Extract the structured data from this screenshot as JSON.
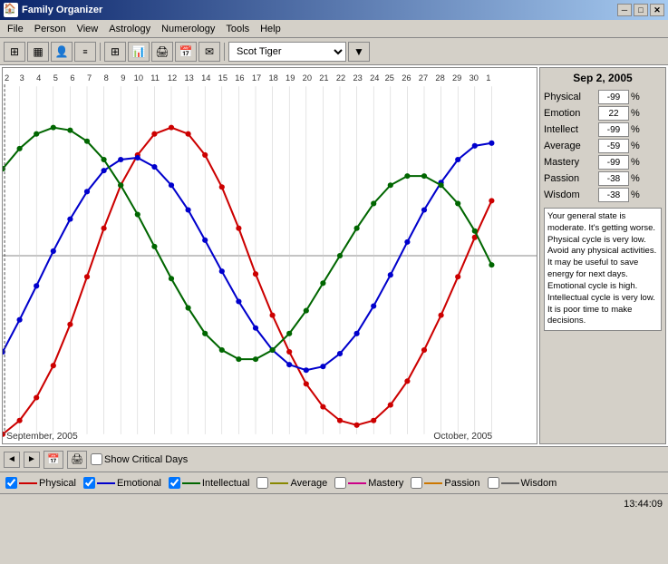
{
  "window": {
    "title": "Family Organizer",
    "icon": "🏠"
  },
  "title_buttons": {
    "minimize": "─",
    "maximize": "□",
    "close": "✕"
  },
  "menu": {
    "items": [
      "File",
      "Person",
      "View",
      "Astrology",
      "Numerology",
      "Tools",
      "Help"
    ]
  },
  "toolbar": {
    "person_name": "Scot Tiger",
    "icons": [
      "📋",
      "🗃️",
      "👤",
      "─",
      "📊",
      "📈",
      "─",
      "📅",
      "🖨️"
    ]
  },
  "right_panel": {
    "date": "Sep 2, 2005",
    "rows": [
      {
        "label": "Physical",
        "value": "-99",
        "pct": "%"
      },
      {
        "label": "Emotion",
        "value": "22",
        "pct": "%"
      },
      {
        "label": "Intellect",
        "value": "-99",
        "pct": "%"
      },
      {
        "label": "Average",
        "value": "-59",
        "pct": "%"
      },
      {
        "label": "Mastery",
        "value": "-99",
        "pct": "%"
      },
      {
        "label": "Passion",
        "value": "-38",
        "pct": "%"
      },
      {
        "label": "Wisdom",
        "value": "-38",
        "pct": "%"
      }
    ],
    "description": "Your general state is moderate. It's getting worse.\nPhysical cycle is very low. Avoid any physical activities. It may be useful to save energy for next days.\nEmotional cycle is high.\nIntellectual cycle is very low. It is poor time to make decisions."
  },
  "chart": {
    "month_start": "September, 2005",
    "month_end": "October, 2005",
    "day_labels": [
      "2",
      "3",
      "4",
      "5",
      "6",
      "7",
      "8",
      "9",
      "10",
      "11",
      "12",
      "13",
      "14",
      "15",
      "16",
      "17",
      "18",
      "19",
      "20",
      "21",
      "22",
      "23",
      "24",
      "25",
      "26",
      "27",
      "28",
      "29",
      "30",
      "1"
    ],
    "grid_color": "#aaa",
    "physical_color": "#cc0000",
    "emotional_color": "#0000cc",
    "intellectual_color": "#006600"
  },
  "bottom_toolbar": {
    "nav_prev": "◄",
    "nav_next": "►",
    "show_critical_days_label": "Show Critical Days"
  },
  "legend": {
    "items": [
      {
        "label": "Physical",
        "color": "#cc0000",
        "checked": true
      },
      {
        "label": "Emotional",
        "color": "#0000cc",
        "checked": true
      },
      {
        "label": "Intellectual",
        "color": "#006600",
        "checked": true
      },
      {
        "label": "Average",
        "color": "#888800",
        "checked": false
      },
      {
        "label": "Mastery",
        "color": "#cc0088",
        "checked": false
      },
      {
        "label": "Passion",
        "color": "#cc7700",
        "checked": false
      },
      {
        "label": "Wisdom",
        "color": "#666666",
        "checked": false
      }
    ]
  },
  "status_bar": {
    "time": "13:44:09"
  }
}
